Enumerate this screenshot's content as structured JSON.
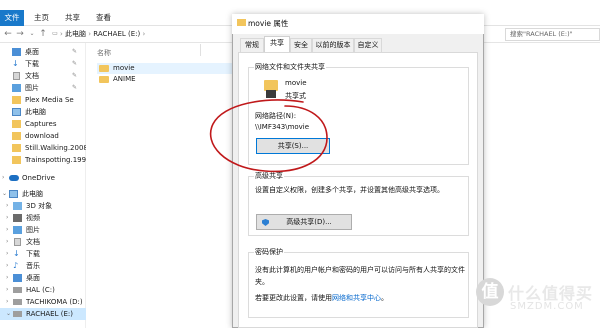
{
  "explorer": {
    "ribbon_tabs": [
      "文件",
      "主页",
      "共享",
      "查看"
    ],
    "breadcrumb": [
      "此电脑",
      "RACHAEL (E:)"
    ],
    "search_placeholder": "搜索\"RACHAEL (E:)\"",
    "column_header": "名称",
    "files": [
      "movie",
      "ANIME"
    ],
    "sidebar": {
      "quick_access": [
        "桌面",
        "下载",
        "文档",
        "图片",
        "Plex Media Se",
        "此电脑",
        "Captures",
        "download",
        "Still.Walking.2008",
        "Trainspotting.199"
      ],
      "onedrive": "OneDrive",
      "this_pc": "此电脑",
      "pc_items": [
        "3D 对象",
        "视频",
        "图片",
        "文档",
        "下载",
        "音乐",
        "桌面",
        "HAL (C:)",
        "TACHIKOMA (D:)",
        "RACHAEL (E:)"
      ]
    }
  },
  "dialog": {
    "title": "movie 属性",
    "tabs": [
      "常规",
      "共享",
      "安全",
      "以前的版本",
      "自定义"
    ],
    "active_tab": "共享",
    "network_group_title": "网络文件和文件夹共享",
    "folder_name": "movie",
    "folder_status": "共享式",
    "network_path_label": "网络路径(N):",
    "network_path": "\\\\IMF343\\movie",
    "share_button": "共享(S)...",
    "advanced_group_title": "高级共享",
    "advanced_desc": "设置自定义权限，创建多个共享，并设置其他高级共享选项。",
    "advanced_button": "高级共享(D)...",
    "password_group_title": "密码保护",
    "password_desc_line1": "没有此计算机的用户帐户和密码的用户可以访问与所有人共享的文件",
    "password_desc_line2": "夹。",
    "password_change_prefix": "若要更改此设置，请使用",
    "password_change_link": "网络和共享中心",
    "password_change_suffix": "。"
  },
  "watermark": {
    "badge": "值",
    "text": "什么值得买",
    "sub": "SMZDM.COM"
  },
  "colors": {
    "accent": "#1979ca",
    "annotation": "#c0191b",
    "link": "#0066cc"
  }
}
